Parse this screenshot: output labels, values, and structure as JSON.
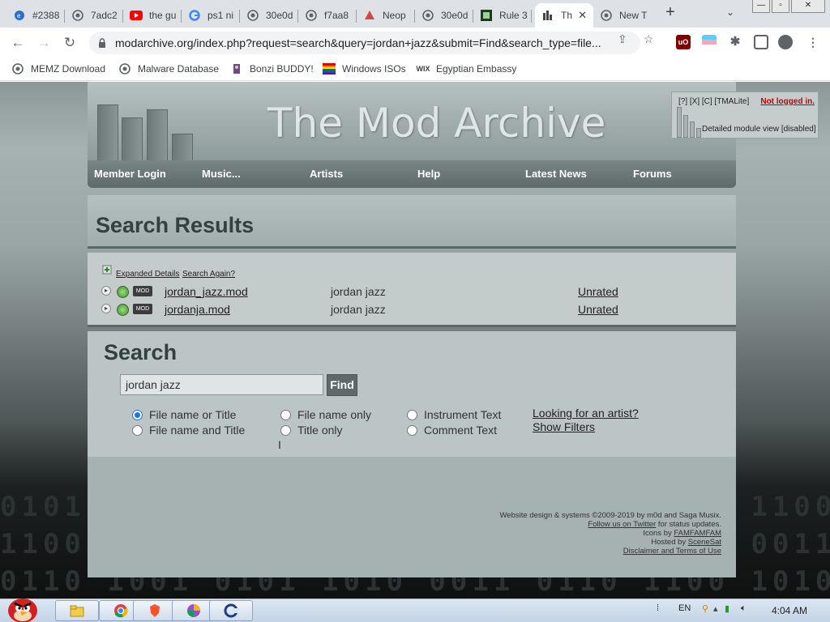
{
  "browser": {
    "tabs": [
      {
        "title": "#2388",
        "icon": "edge-icon"
      },
      {
        "title": "7adc2",
        "icon": "globe-icon"
      },
      {
        "title": "the gu",
        "icon": "youtube-icon"
      },
      {
        "title": "ps1 ni",
        "icon": "google-icon"
      },
      {
        "title": "30e0d",
        "icon": "globe-icon"
      },
      {
        "title": "f7aa8",
        "icon": "globe-icon"
      },
      {
        "title": "Neop",
        "icon": "neopets-icon"
      },
      {
        "title": "30e0d",
        "icon": "globe-icon"
      },
      {
        "title": "Rule 3",
        "icon": "rule34-icon"
      },
      {
        "title": "Th",
        "icon": "modarchive-icon",
        "active": true
      },
      {
        "title": "New T",
        "icon": "chrome-icon"
      }
    ],
    "url": "modarchive.org/index.php?request=search&query=jordan+jazz&submit=Find&search_type=file...",
    "bookmarks": [
      {
        "label": "MEMZ Download",
        "icon": "globe-icon"
      },
      {
        "label": "Malware Database",
        "icon": "globe-icon"
      },
      {
        "label": "Bonzi BUDDY!",
        "icon": "bonzi-icon"
      },
      {
        "label": "Windows ISOs",
        "icon": "windows-flag-icon"
      },
      {
        "label": "Egyptian Embassy",
        "icon": "wix-icon"
      }
    ]
  },
  "site": {
    "title": "The Mod Archive",
    "status_links": "[?] [X] [C] [TMALite]",
    "login_status": "Not logged in.",
    "view_mode": "Detailed module view [disabled]",
    "nav": [
      "Member Login",
      "Music...",
      "Artists",
      "Help",
      "Latest News",
      "Forums"
    ]
  },
  "results": {
    "heading": "Search Results",
    "expanded_details": "Expanded Details",
    "search_again": "Search Again?",
    "rows": [
      {
        "format": "MOD",
        "filename": "jordan_jazz.mod",
        "title": "jordan jazz",
        "rating": "Unrated"
      },
      {
        "format": "MOD",
        "filename": "jordanja.mod",
        "title": "jordan jazz",
        "rating": "Unrated"
      }
    ]
  },
  "search": {
    "heading": "Search",
    "query": "jordan jazz",
    "find_label": "Find",
    "options": [
      {
        "label": "File name or Title",
        "selected": true
      },
      {
        "label": "File name and Title",
        "selected": false
      },
      {
        "label": "File name only",
        "selected": false
      },
      {
        "label": "Title only",
        "selected": false
      },
      {
        "label": "Instrument Text",
        "selected": false
      },
      {
        "label": "Comment Text",
        "selected": false
      }
    ],
    "artist_link": "Looking for an artist?",
    "filters_link": "Show Filters"
  },
  "footer": {
    "line1": "Website design & systems ©2009-2019 by m0d and Saga Musix.",
    "twitter_link": "Follow us on Twitter",
    "twitter_suffix": " for status updates.",
    "icons_prefix": "Icons by ",
    "icons_link": "FAMFAMFAM",
    "hosted_prefix": "Hosted by ",
    "hosted_link": "SceneSat",
    "disclaimer": "Disclaimer and Terms of Use"
  },
  "taskbar": {
    "language": "EN",
    "time": "4:04 AM"
  }
}
